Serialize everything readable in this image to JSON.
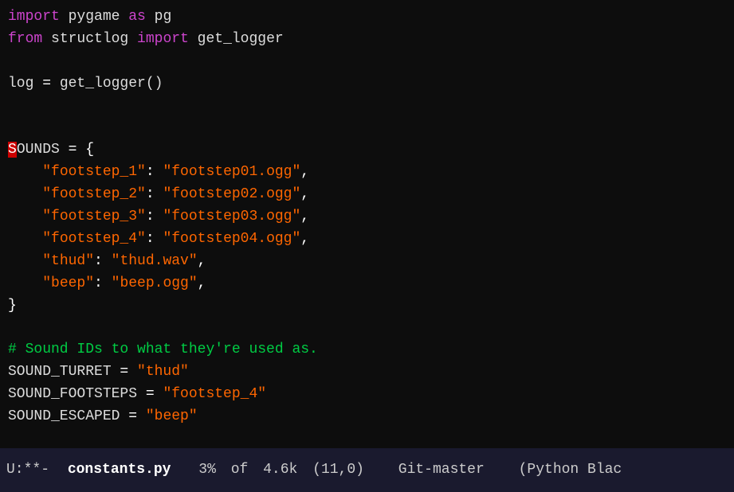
{
  "editor": {
    "background": "#0d0d0d",
    "lines": [
      {
        "id": 1,
        "content": "import pygame as pg",
        "tokens": [
          {
            "text": "import",
            "cls": "kw-import"
          },
          {
            "text": " pygame ",
            "cls": "mod-name"
          },
          {
            "text": "as",
            "cls": "kw-as"
          },
          {
            "text": " pg",
            "cls": "mod-name"
          }
        ]
      },
      {
        "id": 2,
        "content": "from structlog import get_logger",
        "tokens": [
          {
            "text": "from",
            "cls": "kw-from"
          },
          {
            "text": " structlog ",
            "cls": "mod-name"
          },
          {
            "text": "import",
            "cls": "kw-import"
          },
          {
            "text": " get_logger",
            "cls": "func-name"
          }
        ]
      },
      {
        "id": 3,
        "content": ""
      },
      {
        "id": 4,
        "content": "log = get_logger()",
        "tokens": [
          {
            "text": "log",
            "cls": "var-name"
          },
          {
            "text": " = ",
            "cls": "op"
          },
          {
            "text": "get_logger()",
            "cls": "func-name"
          }
        ]
      },
      {
        "id": 5,
        "content": ""
      },
      {
        "id": 6,
        "content": ""
      },
      {
        "id": 7,
        "content": "SOUNDS = {",
        "tokens": [
          {
            "text": "S",
            "cls": "error-mark"
          },
          {
            "text": "OUNDS",
            "cls": "const-name"
          },
          {
            "text": " = ",
            "cls": "equals"
          },
          {
            "text": "{",
            "cls": "bracket"
          }
        ]
      },
      {
        "id": 8,
        "content": "    \"footstep_1\": \"footstep01.ogg\","
      },
      {
        "id": 9,
        "content": "    \"footstep_2\": \"footstep02.ogg\","
      },
      {
        "id": 10,
        "content": "    \"footstep_3\": \"footstep03.ogg\","
      },
      {
        "id": 11,
        "content": "    \"footstep_4\": \"footstep04.ogg\","
      },
      {
        "id": 12,
        "content": "    \"thud\": \"thud.wav\","
      },
      {
        "id": 13,
        "content": "    \"beep\": \"beep.ogg\","
      },
      {
        "id": 14,
        "content": "}"
      },
      {
        "id": 15,
        "content": ""
      },
      {
        "id": 16,
        "content": "# Sound IDs to what they're used as."
      },
      {
        "id": 17,
        "content": "SOUND_TURRET = \"thud\""
      },
      {
        "id": 18,
        "content": "SOUND_FOOTSTEPS = \"footstep_4\""
      },
      {
        "id": 19,
        "content": "SOUND_ESCAPED = \"beep\""
      }
    ]
  },
  "statusbar": {
    "mode": "U:**-",
    "filename": "constants.py",
    "percent": "3%",
    "of_label": "of",
    "size": "4.6k",
    "position": "(11,0)",
    "git": "Git-master",
    "syntax": "(Python Blac"
  }
}
